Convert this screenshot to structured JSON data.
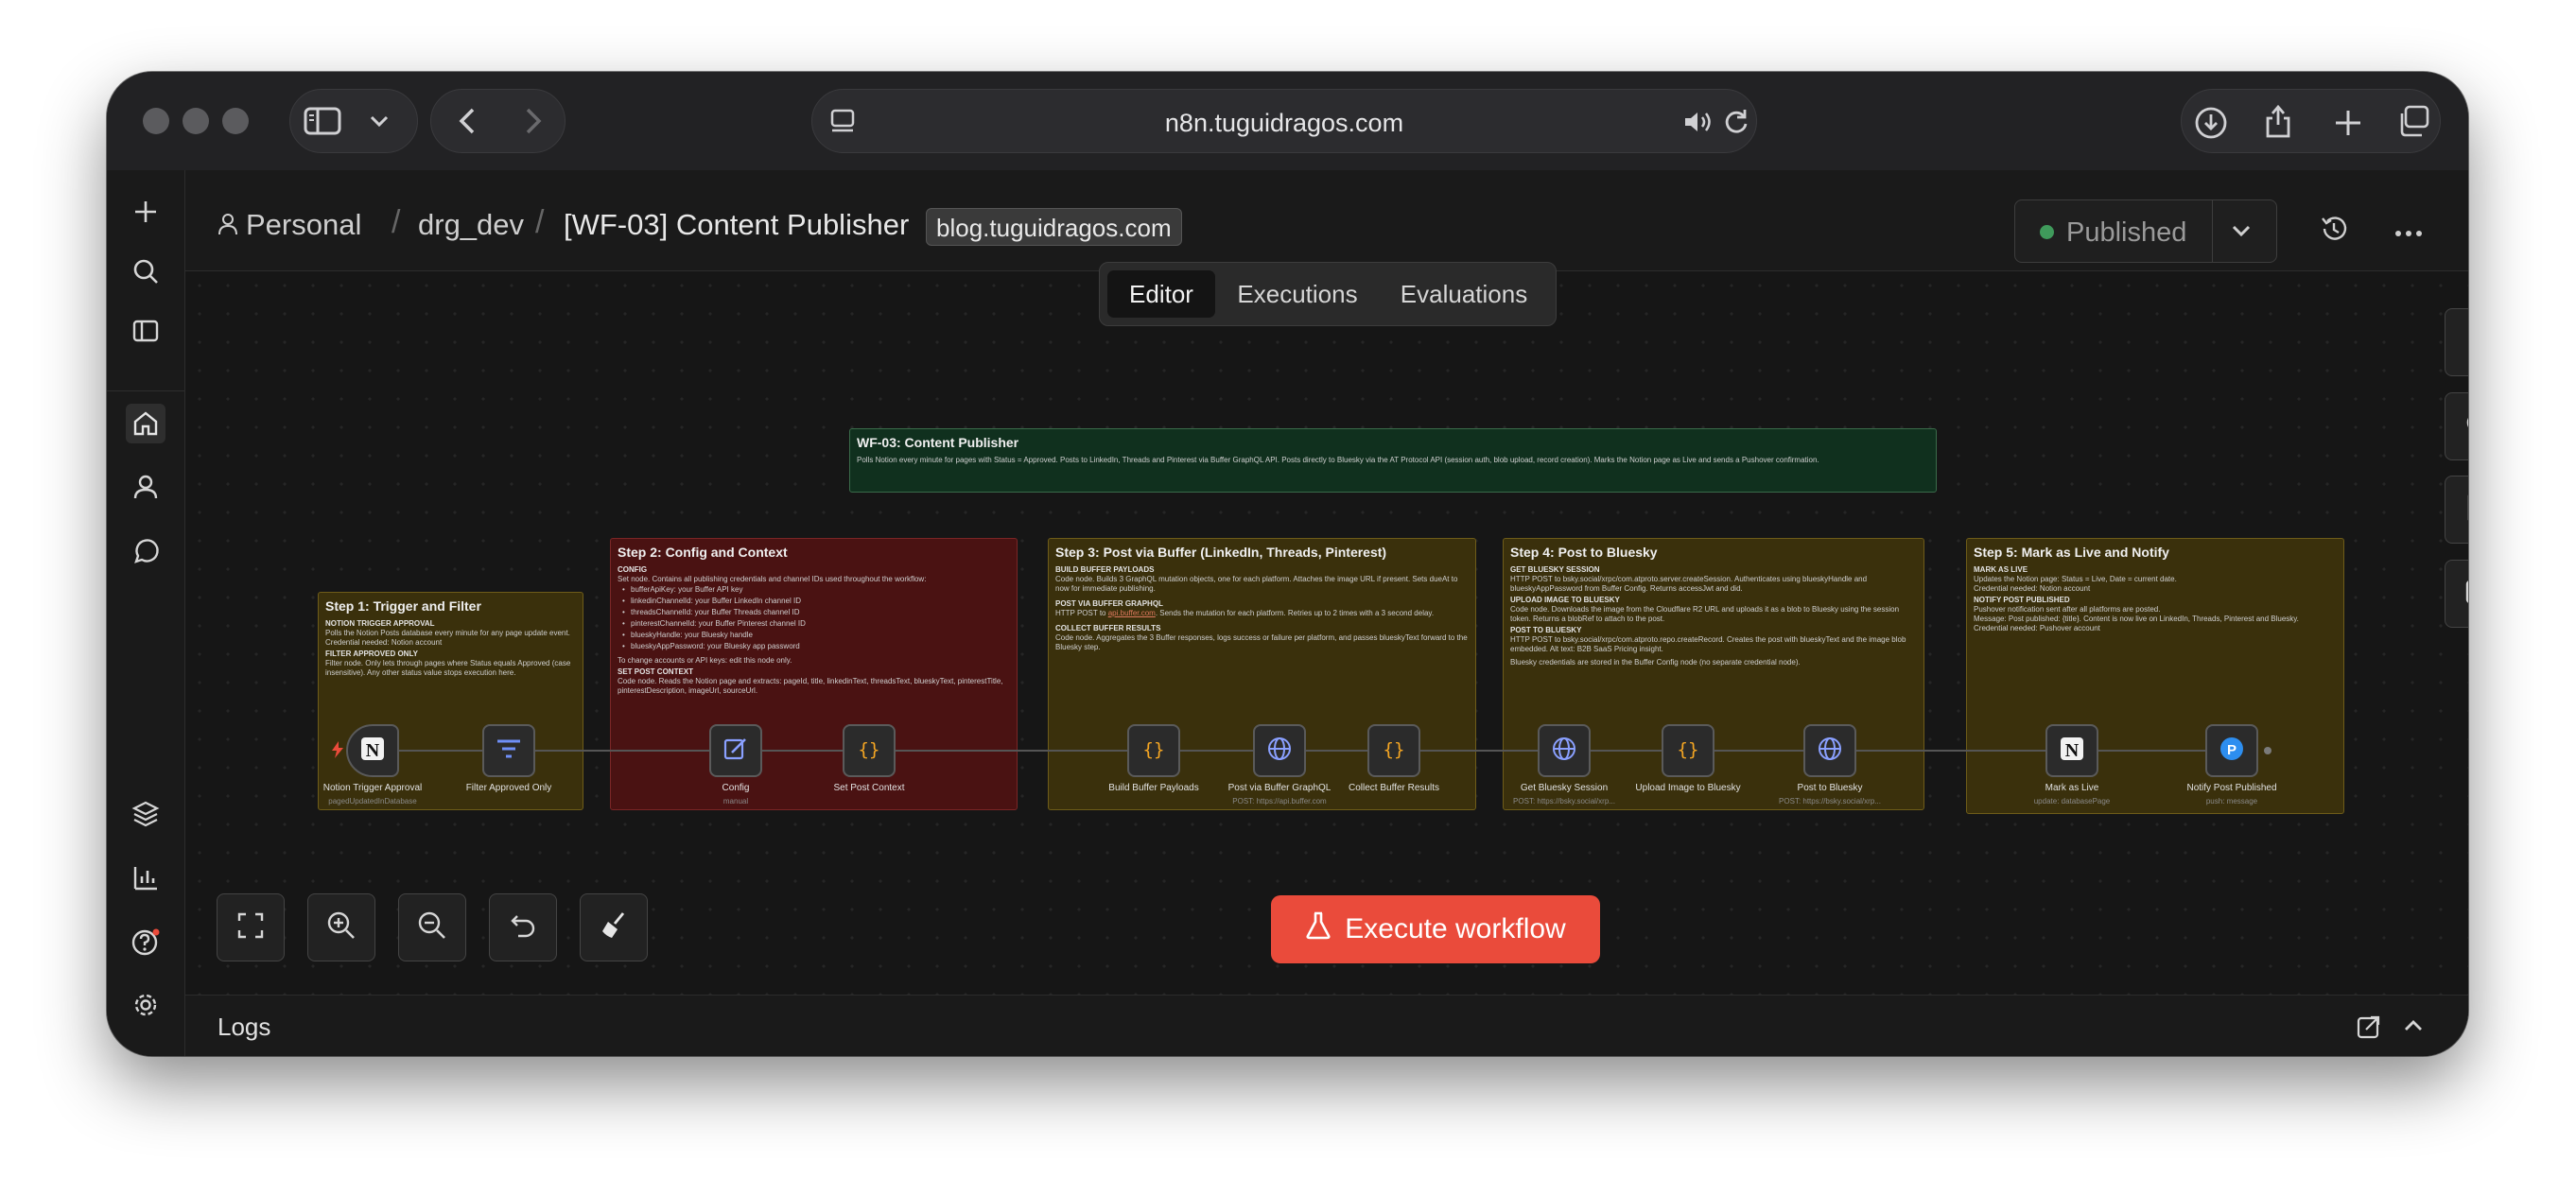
{
  "browser": {
    "url": "n8n.tuguidragos.com"
  },
  "header": {
    "crumb_personal": "Personal",
    "crumb_project": "drg_dev",
    "workflow_name": "[WF-03] Content Publisher",
    "tag": "blog.tuguidragos.com",
    "published_label": "Published"
  },
  "tabs": [
    "Editor",
    "Executions",
    "Evaluations"
  ],
  "colors": {
    "accent": "#ea4b3b",
    "published_dot": "#3f9a5b",
    "sticky_yellow": "#3a300c",
    "sticky_red": "#4a1212",
    "sticky_green": "#10301e"
  },
  "stickies": {
    "overview": {
      "title": "WF-03: Content Publisher",
      "text": "Polls Notion every minute for pages with Status = Approved. Posts to LinkedIn, Threads and Pinterest via Buffer GraphQL API. Posts directly to Bluesky via the AT Protocol API (session auth, blob upload, record creation). Marks the Notion page as Live and sends a Pushover confirmation."
    },
    "step1": {
      "title": "Step 1: Trigger and Filter",
      "h1": "NOTION TRIGGER APPROVAL",
      "t1": "Polls the Notion Posts database every minute for any page update event.",
      "t1b": "Credential needed: Notion account",
      "h2": "FILTER APPROVED ONLY",
      "t2": "Filter node. Only lets through pages where Status equals Approved (case insensitive). Any other status value stops execution here."
    },
    "step2": {
      "title": "Step 2: Config and Context",
      "h1": "CONFIG",
      "t1": "Set node. Contains all publishing credentials and channel IDs used throughout the workflow:",
      "bullets": [
        "bufferApiKey: your Buffer API key",
        "linkedinChannelId: your Buffer LinkedIn channel ID",
        "threadsChannelId: your Buffer Threads channel ID",
        "pinterestChannelId: your Buffer Pinterest channel ID",
        "blueskyHandle: your Bluesky handle",
        "blueskyAppPassword: your Bluesky app password"
      ],
      "t2": "To change accounts or API keys: edit this node only.",
      "h2": "SET POST CONTEXT",
      "t3": "Code node. Reads the Notion page and extracts: pageId, title, linkedinText, threadsText, blueskyText, pinterestTitle, pinterestDescription, imageUrl, sourceUrl."
    },
    "step3": {
      "title": "Step 3: Post via Buffer (LinkedIn, Threads, Pinterest)",
      "h1": "BUILD BUFFER PAYLOADS",
      "t1": "Code node. Builds 3 GraphQL mutation objects, one for each platform. Attaches the image URL if present. Sets dueAt to now for immediate publishing.",
      "h2": "POST VIA BUFFER GRAPHQL",
      "t2a": "HTTP POST to ",
      "t2link": "api.buffer.com",
      "t2b": ". Sends the mutation for each platform. Retries up to 2 times with a 3 second delay.",
      "h3": "COLLECT BUFFER RESULTS",
      "t3": "Code node. Aggregates the 3 Buffer responses, logs success or failure per platform, and passes blueskyText forward to the Bluesky step."
    },
    "step4": {
      "title": "Step 4: Post to Bluesky",
      "h1": "GET BLUESKY SESSION",
      "t1": "HTTP POST to bsky.social/xrpc/com.atproto.server.createSession. Authenticates using blueskyHandle and blueskyAppPassword from Buffer Config. Returns accessJwt and did.",
      "h2": "UPLOAD IMAGE TO BLUESKY",
      "t2": "Code node. Downloads the image from the Cloudflare R2 URL and uploads it as a blob to Bluesky using the session token. Returns a blobRef to attach to the post.",
      "h3": "POST TO BLUESKY",
      "t3": "HTTP POST to bsky.social/xrpc/com.atproto.repo.createRecord. Creates the post with blueskyText and the image blob embedded. Alt text: B2B SaaS Pricing insight.",
      "t4": "Bluesky credentials are stored in the Buffer Config node (no separate credential node)."
    },
    "step5": {
      "title": "Step 5: Mark as Live and Notify",
      "h1": "MARK AS LIVE",
      "t1": "Updates the Notion page: Status = Live, Date = current date.",
      "t1b": "Credential needed: Notion account",
      "h2": "NOTIFY POST PUBLISHED",
      "t2": "Pushover notification sent after all platforms are posted.",
      "t3": "Message: Post published: {title}. Content is now live on LinkedIn, Threads, Pinterest and Bluesky.",
      "t4": "Credential needed: Pushover account"
    }
  },
  "nodes": [
    {
      "label": "Notion Trigger Approval",
      "sub": "pagedUpdatedInDatabase",
      "icon": "notion-icon"
    },
    {
      "label": "Filter Approved Only",
      "sub": "",
      "icon": "filter-icon"
    },
    {
      "label": "Config",
      "sub": "manual",
      "icon": "edit-icon"
    },
    {
      "label": "Set Post Context",
      "sub": "",
      "icon": "code-icon"
    },
    {
      "label": "Build Buffer Payloads",
      "sub": "",
      "icon": "code-icon"
    },
    {
      "label": "Post via Buffer GraphQL",
      "sub": "POST: https://api.buffer.com",
      "icon": "globe-icon"
    },
    {
      "label": "Collect Buffer Results",
      "sub": "",
      "icon": "code-icon"
    },
    {
      "label": "Get Bluesky Session",
      "sub": "POST: https://bsky.social/xrp...",
      "icon": "globe-icon"
    },
    {
      "label": "Upload Image to Bluesky",
      "sub": "",
      "icon": "code-icon"
    },
    {
      "label": "Post to Bluesky",
      "sub": "POST: https://bsky.social/xrp...",
      "icon": "globe-icon"
    },
    {
      "label": "Mark as Live",
      "sub": "update: databasePage",
      "icon": "notion-icon"
    },
    {
      "label": "Notify Post Published",
      "sub": "push: message",
      "icon": "pushover-icon"
    }
  ],
  "execute_label": "Execute workflow",
  "logs_label": "Logs"
}
